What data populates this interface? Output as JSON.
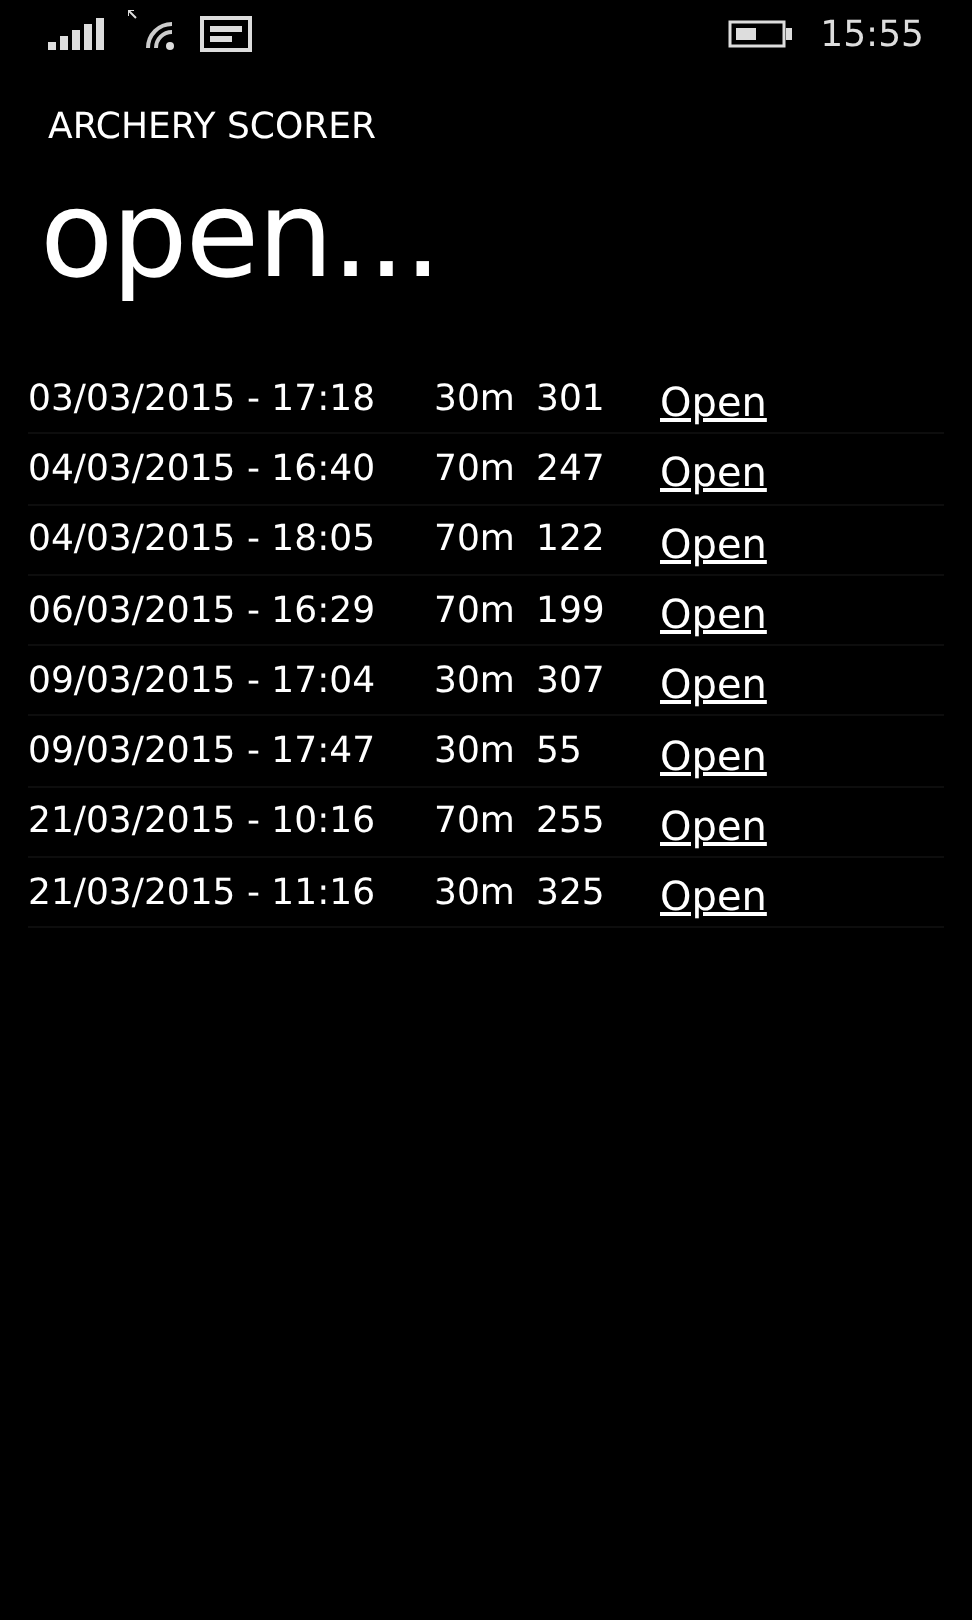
{
  "status_bar": {
    "time": "15:55"
  },
  "app_title": "ARCHERY SCORER",
  "page_title": "open...",
  "sessions": [
    {
      "date": "03/03/2015 - 17:18",
      "distance": "30m",
      "score": "301",
      "action": "Open"
    },
    {
      "date": "04/03/2015 - 16:40",
      "distance": "70m",
      "score": "247",
      "action": "Open"
    },
    {
      "date": "04/03/2015 - 18:05",
      "distance": "70m",
      "score": "122",
      "action": "Open"
    },
    {
      "date": "06/03/2015 - 16:29",
      "distance": "70m",
      "score": "199",
      "action": "Open"
    },
    {
      "date": "09/03/2015 - 17:04",
      "distance": "30m",
      "score": "307",
      "action": "Open"
    },
    {
      "date": "09/03/2015 - 17:47",
      "distance": "30m",
      "score": "55",
      "action": "Open"
    },
    {
      "date": "21/03/2015 - 10:16",
      "distance": "70m",
      "score": "255",
      "action": "Open"
    },
    {
      "date": "21/03/2015 - 11:16",
      "distance": "30m",
      "score": "325",
      "action": "Open"
    }
  ]
}
